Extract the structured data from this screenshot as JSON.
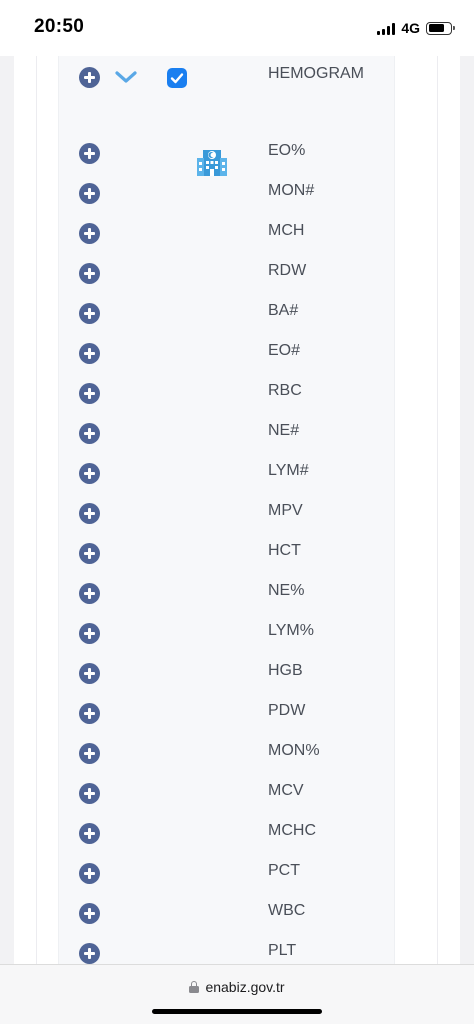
{
  "status": {
    "time": "20:50",
    "network": "4G",
    "battery_level": 0.72
  },
  "header": {
    "title": "HEMOGRAM",
    "checked": true,
    "icons": [
      "plus-circle-icon",
      "chevron-down-icon",
      "checkbox-checked-icon",
      "hospital-icon"
    ]
  },
  "tests": [
    "EO%",
    "MON#",
    "MCH",
    "RDW",
    "BA#",
    "EO#",
    "RBC",
    "NE#",
    "LYM#",
    "MPV",
    "HCT",
    "NE%",
    "LYM%",
    "HGB",
    "PDW",
    "MON%",
    "MCV",
    "MCHC",
    "PCT",
    "WBC",
    "PLT"
  ],
  "browser": {
    "url": "enabiz.gov.tr"
  },
  "colors": {
    "plus_button": "#4f6496",
    "checkbox": "#1a7ff0",
    "chevron": "#5aa8e6",
    "hospital_icon": "#3a9ad9",
    "label_text": "#4a4f58"
  }
}
